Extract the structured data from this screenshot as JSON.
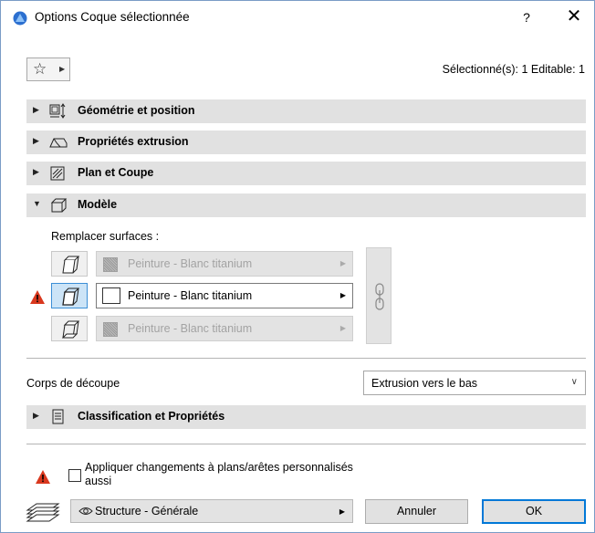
{
  "window": {
    "title": "Options Coque sélectionnée",
    "help_label": "?",
    "close_label": "✕"
  },
  "header": {
    "favorites_icon": "star-icon",
    "selection_info": "Sélectionné(s): 1 Editable: 1"
  },
  "sections": {
    "geometry": "Géométrie et position",
    "extrusion": "Propriétés extrusion",
    "plan": "Plan et Coupe",
    "model": "Modèle",
    "classification": "Classification et Propriétés"
  },
  "model": {
    "replace_label": "Remplacer surfaces :",
    "surfaces": [
      {
        "name": "Peinture - Blanc titanium",
        "enabled": false
      },
      {
        "name": "Peinture - Blanc titanium",
        "enabled": true
      },
      {
        "name": "Peinture - Blanc titanium",
        "enabled": false
      }
    ]
  },
  "corps": {
    "label": "Corps de découpe",
    "value": "Extrusion vers le bas"
  },
  "footer": {
    "apply_label": "Appliquer changements à plans/arêtes personnalisés aussi",
    "layer_value": "Structure - Générale",
    "cancel_label": "Annuler",
    "ok_label": "OK"
  },
  "colors": {
    "accent": "#0078d7",
    "warning": "#d9381e",
    "section_bg": "#e1e1e1"
  }
}
